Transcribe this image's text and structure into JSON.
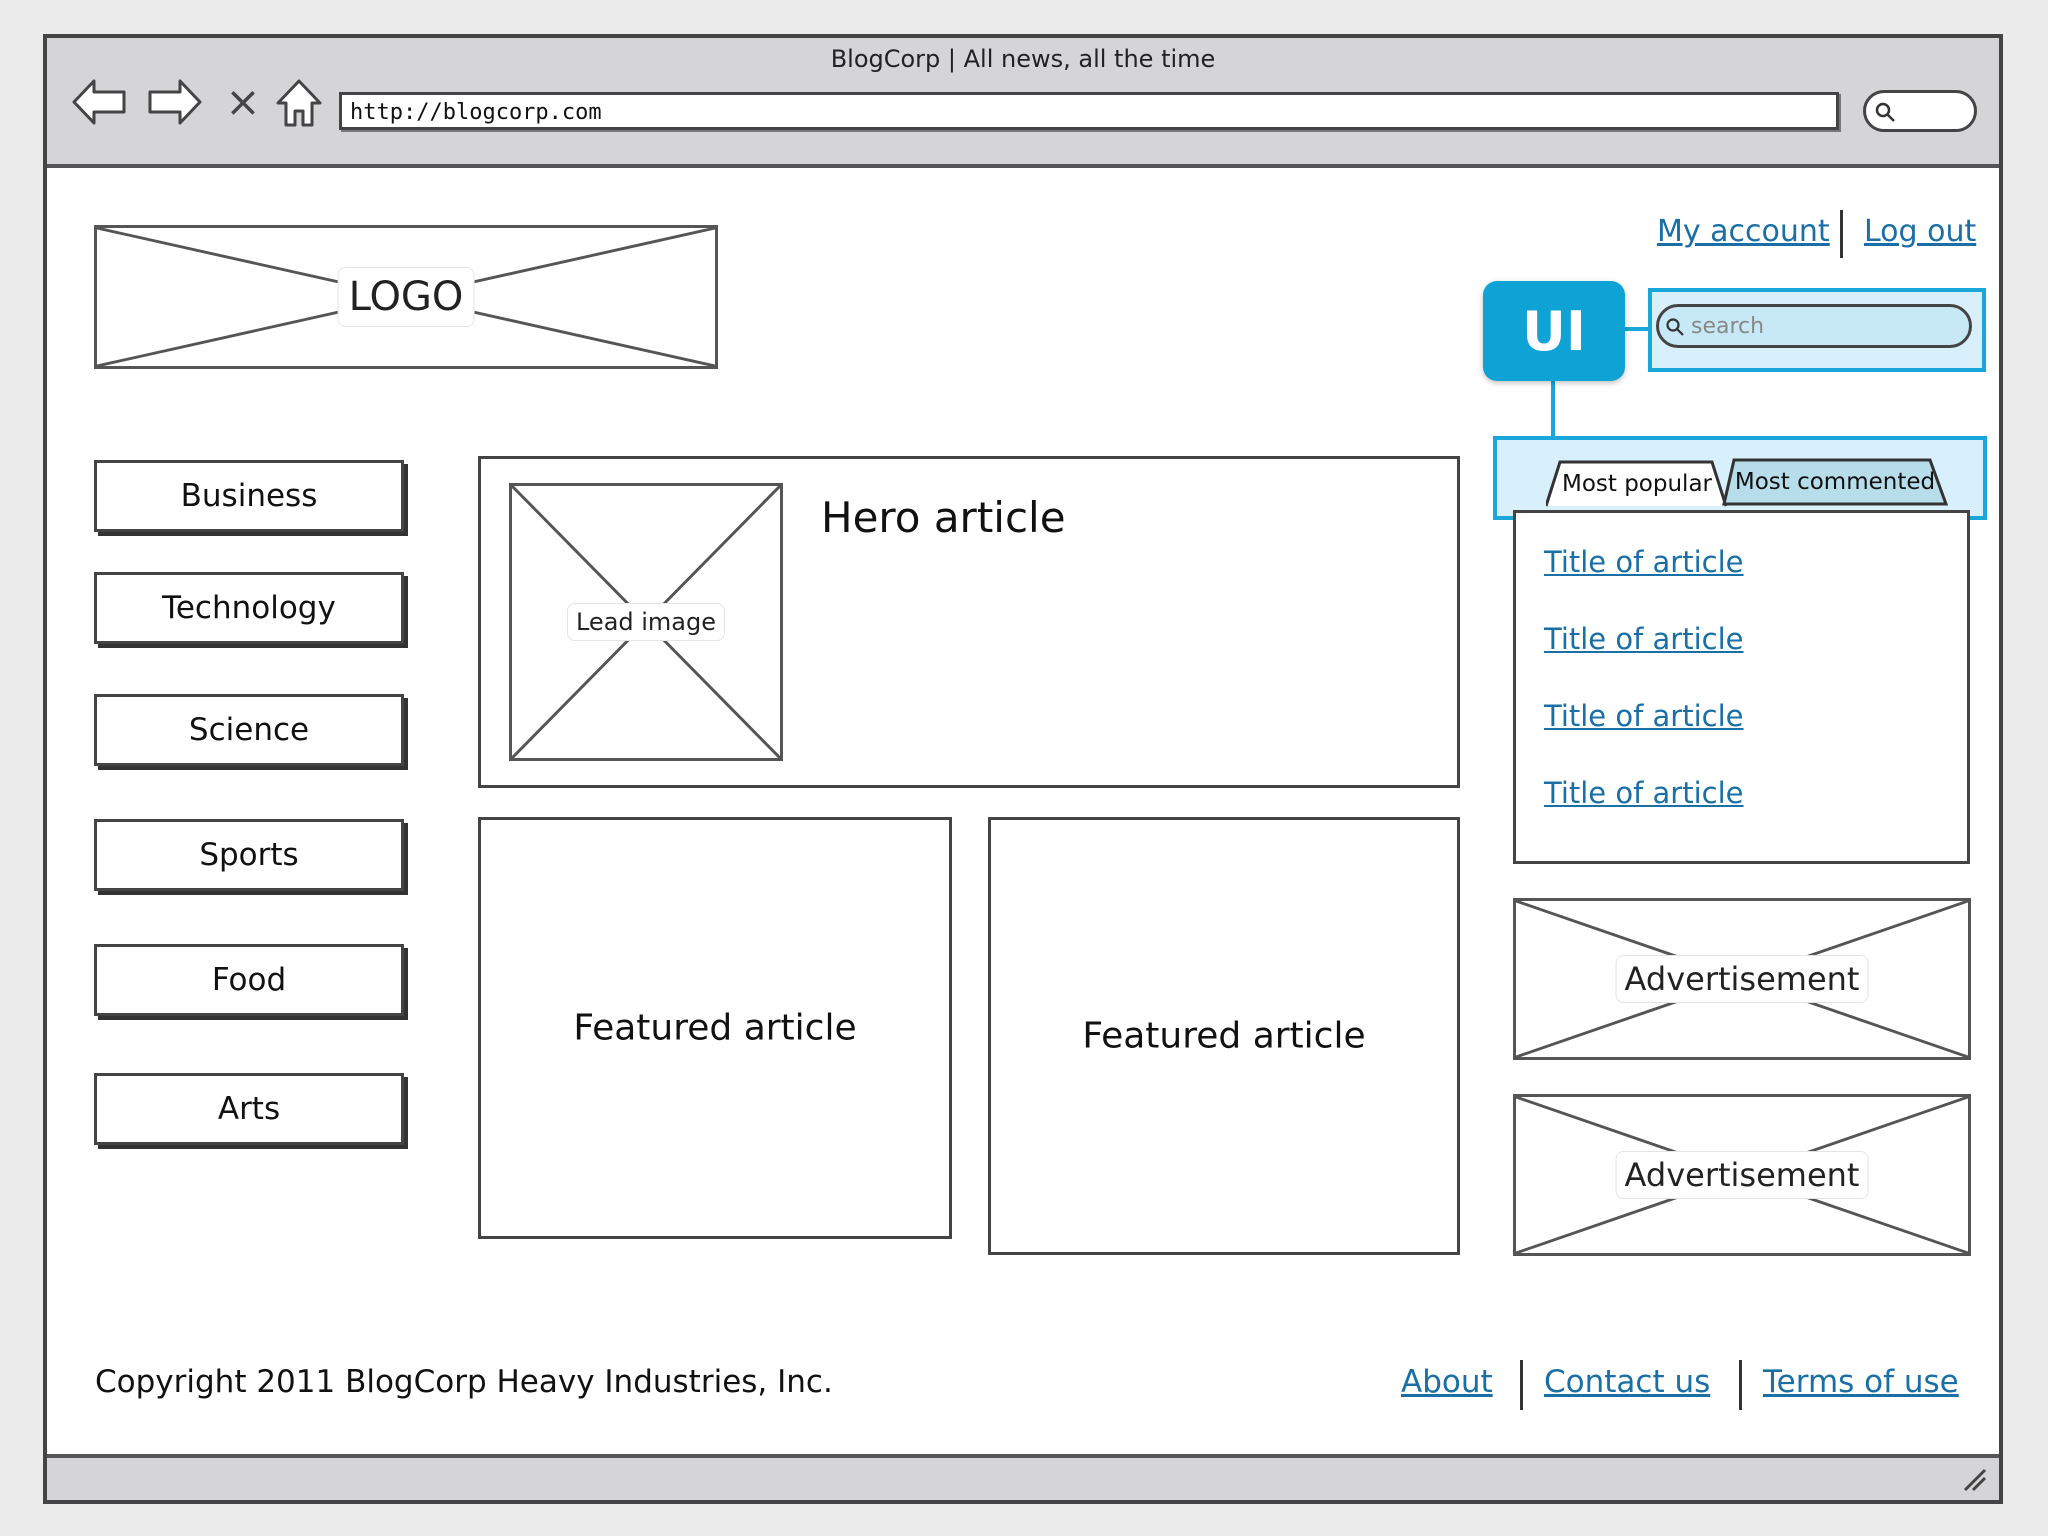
{
  "browser": {
    "title": "BlogCorp | All news, all the time",
    "url": "http://blogcorp.com",
    "nav": {
      "back_icon": "back-arrow-icon",
      "forward_icon": "forward-arrow-icon",
      "stop_glyph": "×",
      "home_icon": "home-icon"
    }
  },
  "header": {
    "logo": "LOGO",
    "account_link": "My account",
    "logout_link": "Log out",
    "search_placeholder": "search",
    "annotation_badge": "UI"
  },
  "categories": [
    "Business",
    "Technology",
    "Science",
    "Sports",
    "Food",
    "Arts"
  ],
  "hero": {
    "title": "Hero article",
    "image_label": "Lead image"
  },
  "featured": [
    {
      "title": "Featured article"
    },
    {
      "title": "Featured article"
    }
  ],
  "sidebar": {
    "tabs": [
      {
        "label": "Most popular",
        "active": true
      },
      {
        "label": "Most commented",
        "active": false
      }
    ],
    "articles": [
      "Title of article",
      "Title of article",
      "Title of article",
      "Title of article"
    ],
    "ads": [
      "Advertisement",
      "Advertisement"
    ]
  },
  "footer": {
    "copyright": "Copyright 2011 BlogCorp Heavy Industries, Inc.",
    "links": [
      "About",
      "Contact us",
      "Terms of use"
    ]
  },
  "colors": {
    "link": "#1a6fa6",
    "highlight_fill": "#d7f0fb",
    "highlight_border": "#19a6d8",
    "badge": "#0fa3d5"
  }
}
